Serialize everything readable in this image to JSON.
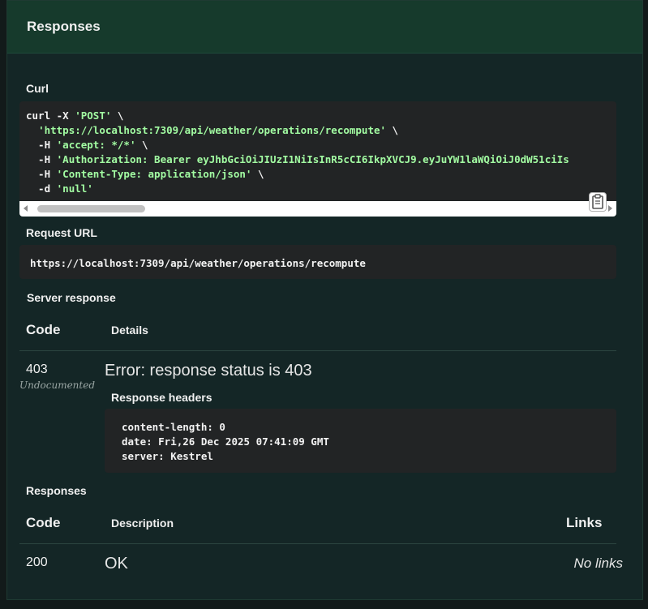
{
  "panel": {
    "title": "Responses"
  },
  "curl": {
    "label": "Curl",
    "lines": [
      {
        "prefix": "curl -X ",
        "str": "'POST'",
        "suffix": " \\"
      },
      {
        "prefix": "  ",
        "str": "'https://localhost:7309/api/weather/operations/recompute'",
        "suffix": " \\"
      },
      {
        "prefix": "  -H ",
        "str": "'accept: */*'",
        "suffix": " \\"
      },
      {
        "prefix": "  -H ",
        "str": "'Authorization: Bearer eyJhbGciOiJIUzI1NiIsInR5cCI6IkpXVCJ9.eyJuYW1laWQiOiJ0dW51ciIs",
        "suffix": ""
      },
      {
        "prefix": "  -H ",
        "str": "'Content-Type: application/json'",
        "suffix": " \\"
      },
      {
        "prefix": "  -d ",
        "str": "'null'",
        "suffix": ""
      }
    ],
    "copy_icon": "clipboard-icon"
  },
  "request_url": {
    "label": "Request URL",
    "value": "https://localhost:7309/api/weather/operations/recompute"
  },
  "server_response": {
    "label": "Server response",
    "col_code": "Code",
    "col_details": "Details",
    "code": "403",
    "undocumented": "Undocumented",
    "error": "Error: response status is 403",
    "headers_label": "Response headers",
    "headers": [
      "content-length: 0",
      "date: Fri,26 Dec 2025 07:41:09 GMT",
      "server: Kestrel"
    ]
  },
  "responses": {
    "label": "Responses",
    "col_code": "Code",
    "col_description": "Description",
    "col_links": "Links",
    "rows": [
      {
        "code": "200",
        "description": "OK",
        "links": "No links"
      }
    ]
  }
}
